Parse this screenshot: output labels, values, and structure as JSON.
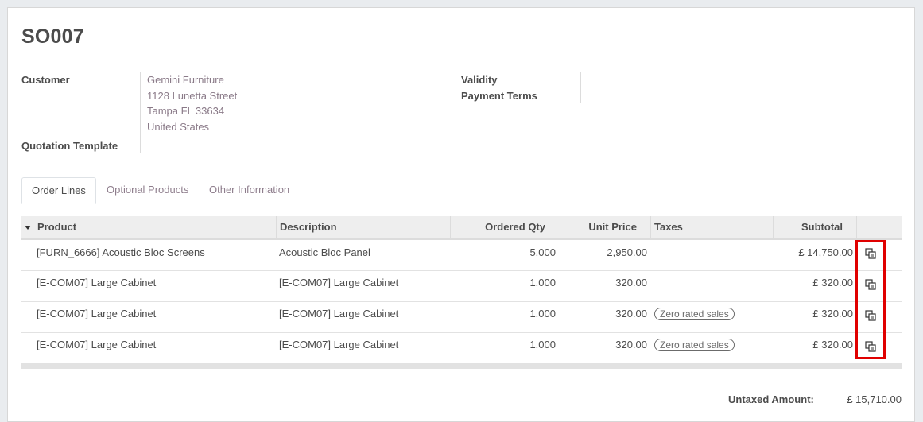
{
  "order": {
    "name": "SO007"
  },
  "form": {
    "customer_label": "Customer",
    "customer_address": [
      "Gemini Furniture",
      "1128 Lunetta Street",
      "Tampa FL 33634",
      "United States"
    ],
    "quotation_template_label": "Quotation Template",
    "validity_label": "Validity",
    "payment_terms_label": "Payment Terms"
  },
  "tabs": [
    {
      "label": "Order Lines",
      "active": true
    },
    {
      "label": "Optional Products",
      "active": false
    },
    {
      "label": "Other Information",
      "active": false
    }
  ],
  "table": {
    "columns": {
      "product": "Product",
      "description": "Description",
      "qty": "Ordered Qty",
      "price": "Unit Price",
      "taxes": "Taxes",
      "subtotal": "Subtotal"
    },
    "rows": [
      {
        "product": "[FURN_6666] Acoustic Bloc Screens",
        "description": "Acoustic Bloc Panel",
        "qty": "5.000",
        "price": "2,950.00",
        "tax": "",
        "subtotal": "£ 14,750.00",
        "action_icon": "copy-icon"
      },
      {
        "product": "[E-COM07] Large Cabinet",
        "description": "[E-COM07] Large Cabinet",
        "qty": "1.000",
        "price": "320.00",
        "tax": "",
        "subtotal": "£ 320.00",
        "action_icon": "copy-icon"
      },
      {
        "product": "[E-COM07] Large Cabinet",
        "description": "[E-COM07] Large Cabinet",
        "qty": "1.000",
        "price": "320.00",
        "tax": "Zero rated sales",
        "subtotal": "£ 320.00",
        "action_icon": "copy-icon"
      },
      {
        "product": "[E-COM07] Large Cabinet",
        "description": "[E-COM07] Large Cabinet",
        "qty": "1.000",
        "price": "320.00",
        "tax": "Zero rated sales",
        "subtotal": "£ 320.00",
        "action_icon": "copy-icon"
      }
    ]
  },
  "totals": {
    "untaxed_label": "Untaxed Amount:",
    "untaxed_value": "£ 15,710.00"
  },
  "colors": {
    "highlight": "#e00000",
    "link_muted": "#8e7d8c"
  }
}
